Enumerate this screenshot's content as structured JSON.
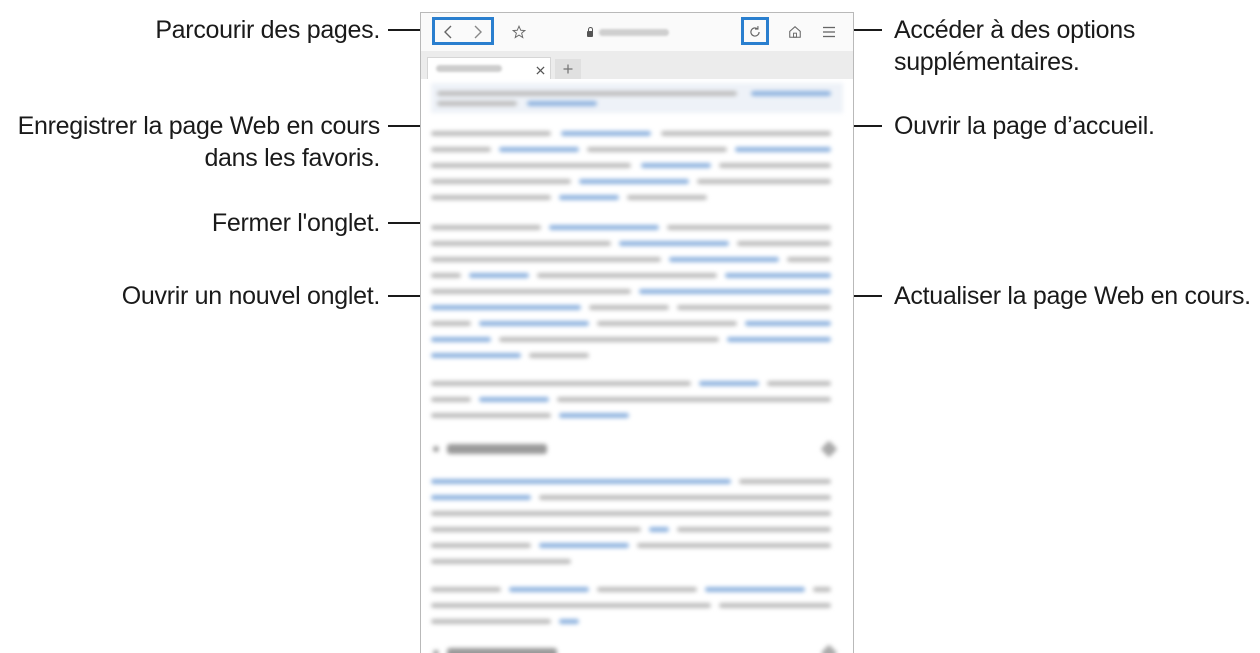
{
  "callouts": {
    "navigate": "Parcourir des pages.",
    "bookmark_line1": "Enregistrer la page Web en cours",
    "bookmark_line2": "dans les favoris.",
    "close_tab": "Fermer l'onglet.",
    "new_tab": "Ouvrir un nouvel onglet.",
    "more_options_line1": "Accéder à des options",
    "more_options_line2": "supplémentaires.",
    "home_page": "Ouvrir la page d’accueil.",
    "refresh": "Actualiser la page Web en cours."
  },
  "browser": {
    "toolbar_icons": [
      "back-icon",
      "forward-icon",
      "star-icon",
      "lock-icon",
      "refresh-icon",
      "home-icon",
      "menu-icon"
    ],
    "tab_icons": [
      "close-icon",
      "plus-icon"
    ],
    "highlight_color": "#2a7fcf",
    "link_color": "#8fb3df"
  }
}
